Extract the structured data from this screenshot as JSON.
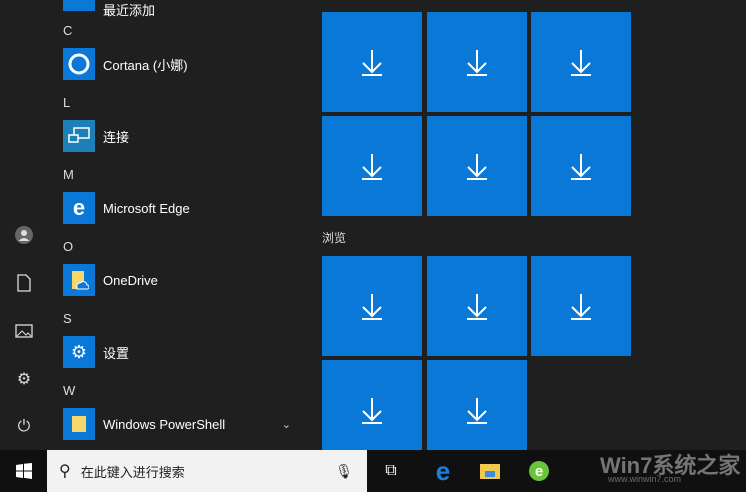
{
  "rail": {
    "items": [
      "user-icon",
      "document-icon",
      "pictures-icon",
      "settings-icon",
      "power-icon"
    ]
  },
  "list": {
    "recent_label": "最近添加",
    "groups": [
      {
        "letter": "C",
        "app": "Cortana (小娜)"
      },
      {
        "letter": "L",
        "app": "连接"
      },
      {
        "letter": "M",
        "app": "Microsoft Edge"
      },
      {
        "letter": "O",
        "app": "OneDrive"
      },
      {
        "letter": "S",
        "app": "设置"
      },
      {
        "letter": "W",
        "app": "Windows PowerShell"
      }
    ]
  },
  "tiles": {
    "group_label": "浏览",
    "download_glyph": "↓"
  },
  "taskbar": {
    "search_placeholder": "在此键入进行搜索"
  },
  "watermark": {
    "text": "Win7系统之家",
    "url": "www.winwin7.com"
  },
  "colors": {
    "accent": "#0a78d7",
    "bg": "#1f1f1f"
  }
}
